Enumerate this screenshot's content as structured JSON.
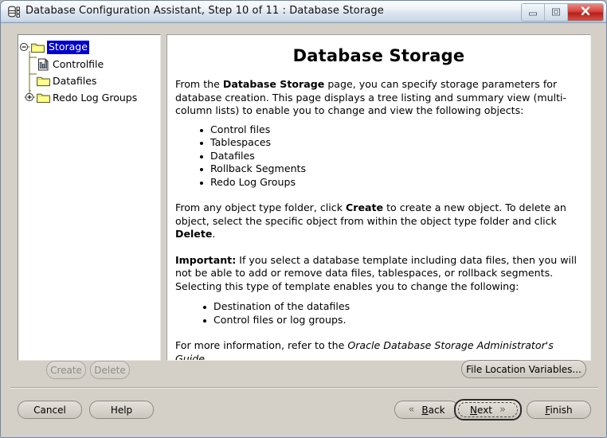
{
  "window": {
    "title": "Database Configuration Assistant, Step 10 of 11 : Database Storage",
    "icon": "database-icon",
    "controls": {
      "minimize_label": "Minimize",
      "maximize_label": "Maximize",
      "close_label": "X"
    }
  },
  "tree": {
    "nodes": [
      {
        "label": "Storage",
        "icon": "folder-icon",
        "expander": "minus",
        "selected": true,
        "level": 0
      },
      {
        "label": "Controlfile",
        "icon": "controlfile-icon",
        "expander": "none",
        "selected": false,
        "level": 1
      },
      {
        "label": "Datafiles",
        "icon": "folder-icon",
        "expander": "none",
        "selected": false,
        "level": 1
      },
      {
        "label": "Redo Log Groups",
        "icon": "folder-icon",
        "expander": "plus",
        "selected": false,
        "level": 1
      }
    ]
  },
  "content": {
    "title": "Database Storage",
    "para1_a": "From the ",
    "para1_b": "Database Storage",
    "para1_c": " page, you can specify storage parameters for database creation. This page displays a tree listing and summary view (multi-column lists) to enable you to change and view the following objects:",
    "list1": [
      "Control files",
      "Tablespaces",
      "Datafiles",
      "Rollback Segments",
      "Redo Log Groups"
    ],
    "para2_a": "From any object type folder, click ",
    "para2_b": "Create",
    "para2_c": " to create a new object. To delete an object, select the specific object from within the object type folder and click ",
    "para2_d": "Delete",
    "para2_e": ".",
    "para3_a": "Important:",
    "para3_b": " If you select a database template including data files, then you will not be able to add or remove data files, tablespaces, or rollback segments. Selecting this type of template enables you to change the following:",
    "list2": [
      "Destination of the datafiles",
      "Control files or log groups."
    ],
    "para4_a": "For more information, refer to the ",
    "para4_b": "Oracle Database Storage Administrator's Guide",
    "para4_c": "."
  },
  "buttons": {
    "create": "Create",
    "delete": "Delete",
    "file_location_variables": "File Location Variables...",
    "cancel": "Cancel",
    "help": "Help",
    "back_mnemonic": "B",
    "back_rest": "ack",
    "next_mnemonic": "N",
    "next_rest": "ext",
    "finish_mnemonic": "F",
    "finish_rest": "inish",
    "back_chevron": "«",
    "next_chevron": "»"
  },
  "colors": {
    "selection_blue": "#0000c8",
    "folder_yellow": "#ffff99",
    "window_face": "#d4d0c8",
    "close_red": "#b32018"
  }
}
